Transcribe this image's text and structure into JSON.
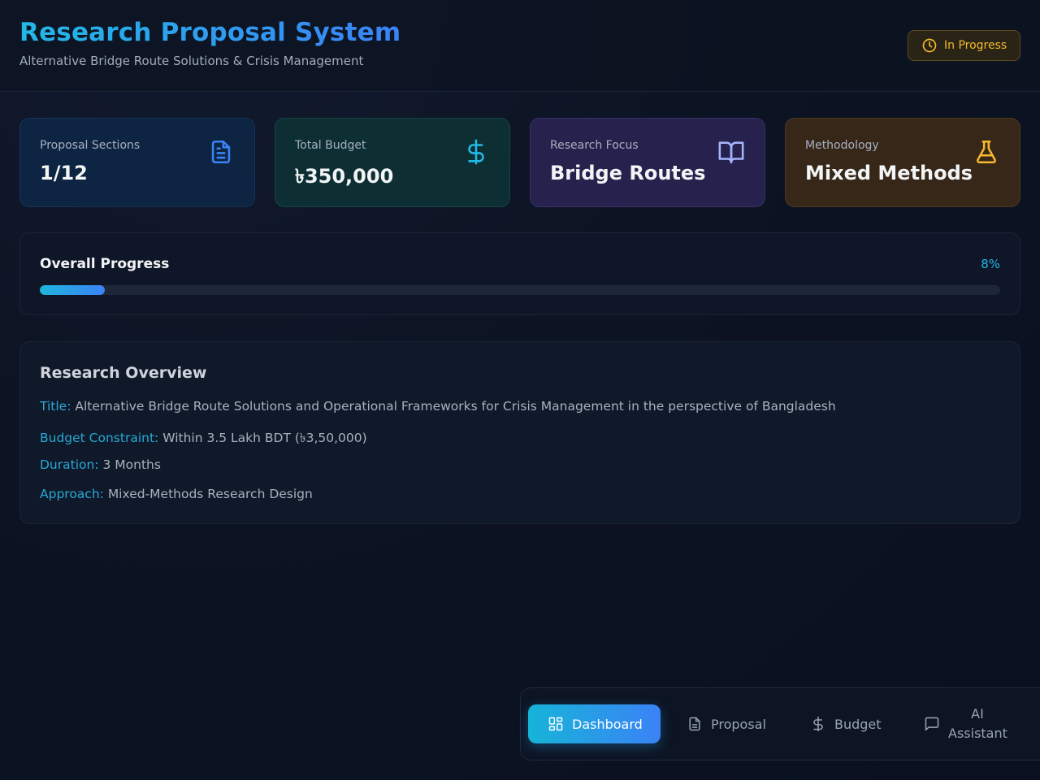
{
  "header": {
    "title": "Research Proposal System",
    "subtitle": "Alternative Bridge Route Solutions & Crisis Management",
    "status": "In Progress"
  },
  "stats": [
    {
      "label": "Proposal Sections",
      "value": "1/12",
      "icon": "file-text-icon",
      "accent": "#3b82f6"
    },
    {
      "label": "Total Budget",
      "value": "৳350,000",
      "icon": "dollar-icon",
      "accent": "#22b8e6"
    },
    {
      "label": "Research Focus",
      "value": "Bridge Routes",
      "icon": "book-open-icon",
      "accent": "#a5b4fc"
    },
    {
      "label": "Methodology",
      "value": "Mixed Methods",
      "icon": "flask-icon",
      "accent": "#f5b82e"
    }
  ],
  "progress": {
    "title": "Overall Progress",
    "percent_label": "8%",
    "value": 0.068
  },
  "overview": {
    "title": "Research Overview",
    "rows": [
      {
        "key": "Title:",
        "value": "Alternative Bridge Route Solutions and Operational Frameworks for Crisis Management in the perspective of Bangladesh"
      },
      {
        "key": "Budget Constraint:",
        "value": "Within 3.5 Lakh BDT (৳3,50,000)"
      },
      {
        "key": "Duration:",
        "value": "3 Months"
      },
      {
        "key": "Approach:",
        "value": "Mixed-Methods Research Design"
      }
    ]
  },
  "nav": {
    "dashboard": "Dashboard",
    "proposal": "Proposal",
    "budget": "Budget",
    "assistant_line1": "AI",
    "assistant_line2": "Assistant",
    "active": "dashboard"
  },
  "colors": {
    "accent": "#22b8e6",
    "brand": "#3b82f6",
    "warning": "#f5b82e"
  }
}
